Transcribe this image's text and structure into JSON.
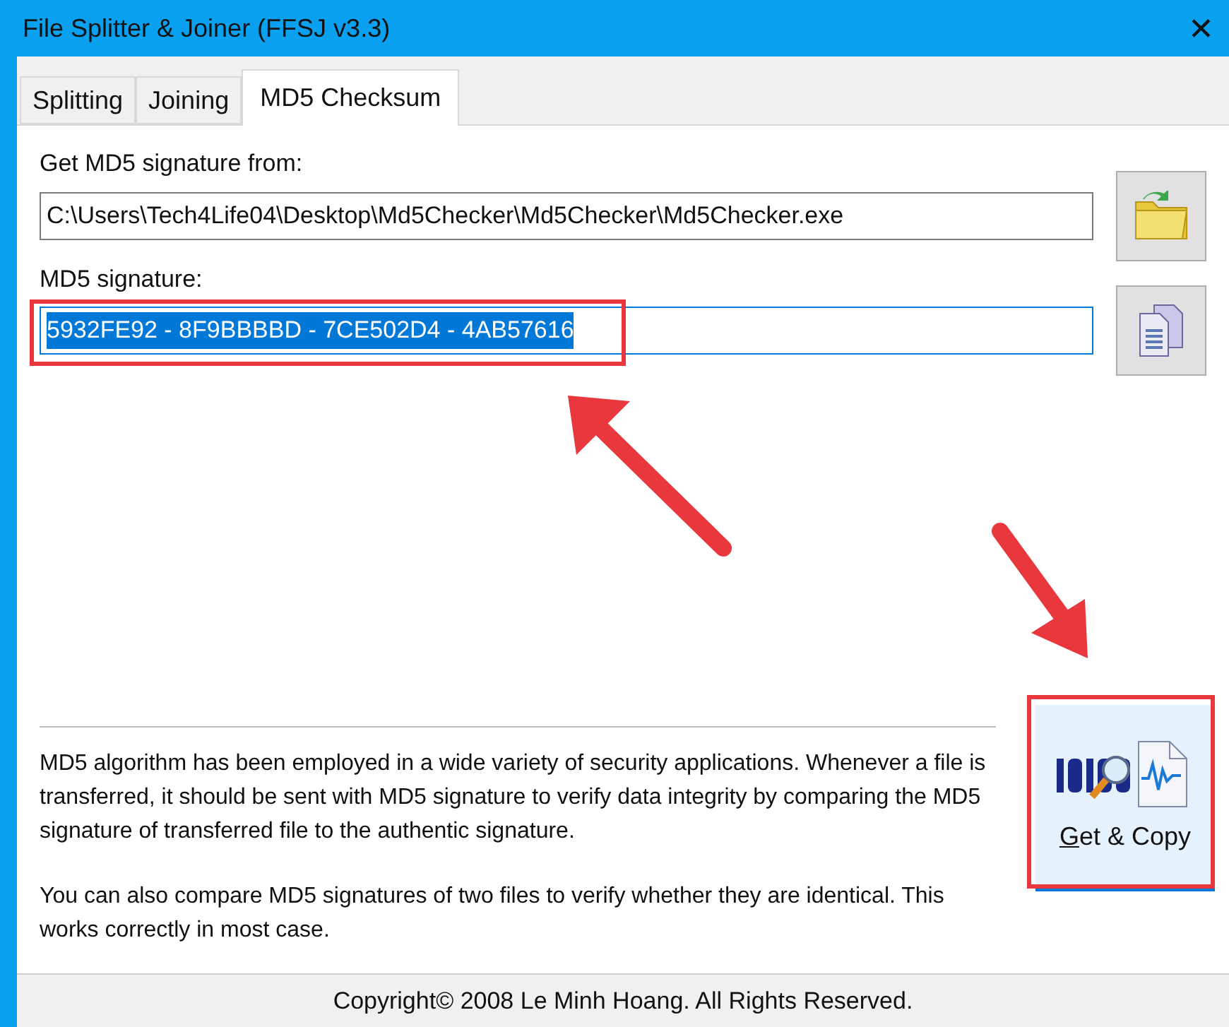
{
  "window": {
    "title": "File Splitter & Joiner (FFSJ v3.3)",
    "close": "✕"
  },
  "tabs": [
    {
      "label": "Splitting",
      "selected": false
    },
    {
      "label": "Joining",
      "selected": false
    },
    {
      "label": "MD5 Checksum",
      "selected": true
    }
  ],
  "source": {
    "label": "Get MD5 signature from:",
    "value": "C:\\Users\\Tech4Life04\\Desktop\\Md5Checker\\Md5Checker\\Md5Checker.exe"
  },
  "signature": {
    "label": "MD5 signature:",
    "value": "5932FE92 - 8F9BBBBD - 7CE502D4 - 4AB57616",
    "selected": true,
    "focused": true
  },
  "description": [
    "MD5 algorithm has been employed in a wide variety of security applications. Whenever a file is transferred, it should be sent with MD5 signature to verify data integrity by comparing the MD5 signature of transferred file to the authentic signature.",
    "You can also compare MD5 signatures of two files to verify whether they are identical. This works correctly in most case."
  ],
  "get_copy_button": {
    "label": "Get & Copy",
    "access_key_underlined": true,
    "hovered": true
  },
  "status_bar": "Copyright© 2008 Le Minh Hoang. All Rights Reserved."
}
